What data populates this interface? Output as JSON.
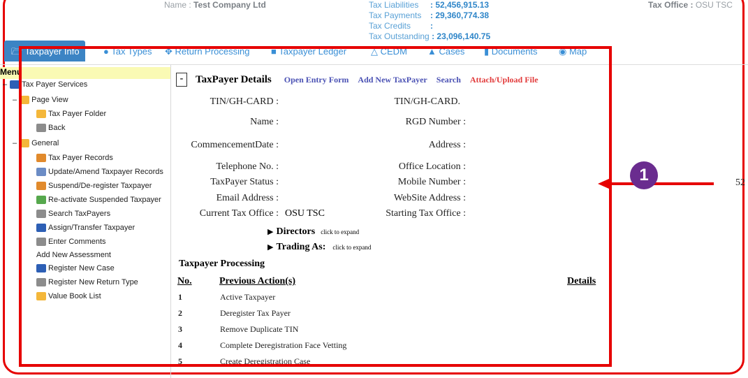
{
  "header": {
    "name_label": "Name :",
    "name_value": "Test Company Ltd",
    "tax_liabilities_label": "Tax Liabilities",
    "tax_liabilities_value": ": 52,456,915.13",
    "tax_payments_label": "Tax Payments",
    "tax_payments_value": ": 29,360,774.38",
    "tax_credits_label": "Tax Credits",
    "tax_credits_value": ":",
    "tax_outstanding_label": "Tax Outstanding",
    "tax_outstanding_value": ": 23,096,140.75",
    "tax_office_label": "Tax Office :",
    "tax_office_value": "OSU TSC"
  },
  "tabs": [
    {
      "label": "Taxpayer Info",
      "icon": "folder-icon",
      "active": true
    },
    {
      "label": "Tax Types",
      "icon": "circle-icon"
    },
    {
      "label": "Return Processing",
      "icon": "arrows-icon"
    },
    {
      "label": "Taxpayer Ledger",
      "icon": "book-icon"
    },
    {
      "label": "CEDM",
      "icon": "triangle-icon"
    },
    {
      "label": "Cases",
      "icon": "pin-icon"
    },
    {
      "label": "Documents",
      "icon": "file-icon"
    },
    {
      "label": "Map",
      "icon": "globe-icon"
    }
  ],
  "sidebar": {
    "menu_label": "Menu",
    "root": "Tax Payer Services",
    "page_view": "Page View",
    "page_view_items": [
      "Tax Payer Folder",
      "Back"
    ],
    "general": "General",
    "general_items": [
      "Tax Payer Records",
      "Update/Amend Taxpayer Records",
      "Suspend/De-register Taxpayer",
      "Re-activate Suspended Taxpayer",
      "Search TaxPayers",
      "Assign/Transfer Taxpayer",
      "Enter Comments",
      "Add New Assessment",
      "Register New Case",
      "Register New Return Type",
      "Value Book List"
    ]
  },
  "details": {
    "collapse_btn": "-",
    "title": "TaxPayer Details",
    "open_entry_form": "Open Entry Form",
    "add_new_taxpayer": "Add New TaxPayer",
    "search": "Search",
    "attach_upload": "Attach/Upload File",
    "fields_left": [
      "TIN/GH-CARD :",
      "Name :",
      "CommencementDate :",
      "Telephone No. :",
      "TaxPayer Status :",
      "Email Address :",
      "Current Tax Office :"
    ],
    "current_tax_office_value": "OSU TSC",
    "fields_right": [
      "TIN/GH-CARD.",
      "RGD Number :",
      "Address :",
      "Office Location :",
      "Mobile Number :",
      "WebSite Address :",
      "Starting Tax Office :"
    ],
    "directors": "Directors",
    "directors_hint": "click to expand",
    "trading_as": "Trading As:",
    "trading_hint": "click to expand"
  },
  "processing": {
    "title": "Taxpayer Processing",
    "col_no": "No.",
    "col_action": "Previous Action(s)",
    "col_details": "Details",
    "rows": [
      {
        "no": "1",
        "action": "Active Taxpayer"
      },
      {
        "no": "2",
        "action": "Deregister Tax Payer"
      },
      {
        "no": "3",
        "action": "Remove Duplicate TIN"
      },
      {
        "no": "4",
        "action": "Complete Deregistration Face Vetting"
      },
      {
        "no": "5",
        "action": "Create Deregistration Case"
      }
    ]
  },
  "annotation": {
    "badge_number": "1",
    "side_text": "52"
  },
  "colors": {
    "annotation": "#e60000",
    "badge": "#6a2c8f",
    "tab_active": "#3c84c4"
  }
}
